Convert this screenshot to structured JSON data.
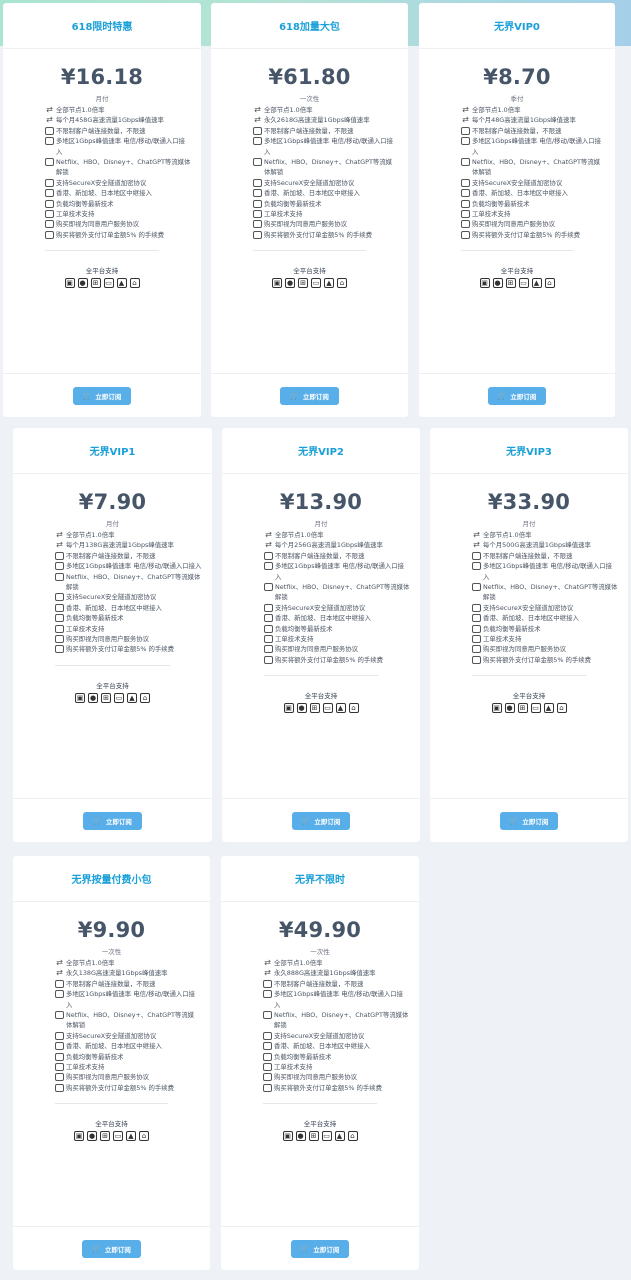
{
  "common": {
    "platform_label": "全平台支持",
    "buy_label": "立即订阅",
    "platform_icons": [
      "android-icon",
      "apple-icon",
      "windows-icon",
      "monitor-icon",
      "linux-icon",
      "router-icon"
    ],
    "feature_icons": [
      "arrows-icon",
      "arrows-icon",
      "user-icon",
      "location-icon",
      "play-icon",
      "shield-icon",
      "route-icon",
      "balance-icon",
      "support-icon",
      "agreement-icon",
      "fee-icon"
    ]
  },
  "plans": [
    {
      "title": "618限时特惠",
      "price": "¥16.18",
      "period": "月付",
      "features": [
        "全部节点1.0倍率",
        "每个月458G高速流量1Gbps峰值速率",
        "不限制客户端连接数量，不限速",
        "多地区1Gbps峰值速率 电信/移动/联通入口接入",
        "Netflix、HBO、Disney+、ChatGPT等流媒体解锁",
        "支持SecureX安全隧道加密协议",
        "香港、新加坡、日本地区中继接入",
        "负载均衡等最新技术",
        "工单技术支持",
        "购买即视为同意用户服务协议",
        "购买将额外支付订单金额5% 的手续费"
      ]
    },
    {
      "title": "618加量大包",
      "price": "¥61.80",
      "period": "一次性",
      "features": [
        "全部节点1.0倍率",
        "永久2618G高速流量1Gbps峰值速率",
        "不限制客户端连接数量，不限速",
        "多地区1Gbps峰值速率 电信/移动/联通入口接入",
        "Netflix、HBO、Disney+、ChatGPT等流媒体解锁",
        "支持SecureX安全隧道加密协议",
        "香港、新加坡、日本地区中继接入",
        "负载均衡等最新技术",
        "工单技术支持",
        "购买即视为同意用户服务协议",
        "购买将额外支付订单金额5% 的手续费"
      ]
    },
    {
      "title": "无界VIP0",
      "price": "¥8.70",
      "period": "季付",
      "features": [
        "全部节点1.0倍率",
        "每个月48G高速流量1Gbps峰值速率",
        "不限制客户端连接数量，不限速",
        "多地区1Gbps峰值速率 电信/移动/联通入口接入",
        "Netflix、HBO、Disney+、ChatGPT等流媒体解锁",
        "支持SecureX安全隧道加密协议",
        "香港、新加坡、日本地区中继接入",
        "负载均衡等最新技术",
        "工单技术支持",
        "购买即视为同意用户服务协议",
        "购买将额外支付订单金额5% 的手续费"
      ]
    },
    {
      "title": "无界VIP1",
      "price": "¥7.90",
      "period": "月付",
      "features": [
        "全部节点1.0倍率",
        "每个月138G高速流量1Gbps峰值速率",
        "不限制客户端连接数量，不限速",
        "多地区1Gbps峰值速率 电信/移动/联通入口接入",
        "Netflix、HBO、Disney+、ChatGPT等流媒体解锁",
        "支持SecureX安全隧道加密协议",
        "香港、新加坡、日本地区中继接入",
        "负载均衡等最新技术",
        "工单技术支持",
        "购买即视为同意用户服务协议",
        "购买将额外支付订单金额5% 的手续费"
      ]
    },
    {
      "title": "无界VIP2",
      "price": "¥13.90",
      "period": "月付",
      "features": [
        "全部节点1.0倍率",
        "每个月256G高速流量1Gbps峰值速率",
        "不限制客户端连接数量，不限速",
        "多地区1Gbps峰值速率 电信/移动/联通入口接入",
        "Netflix、HBO、Disney+、ChatGPT等流媒体解锁",
        "支持SecureX安全隧道加密协议",
        "香港、新加坡、日本地区中继接入",
        "负载均衡等最新技术",
        "工单技术支持",
        "购买即视为同意用户服务协议",
        "购买将额外支付订单金额5% 的手续费"
      ]
    },
    {
      "title": "无界VIP3",
      "price": "¥33.90",
      "period": "月付",
      "features": [
        "全部节点1.0倍率",
        "每个月500G高速流量1Gbps峰值速率",
        "不限制客户端连接数量，不限速",
        "多地区1Gbps峰值速率 电信/移动/联通入口接入",
        "Netflix、HBO、Disney+、ChatGPT等流媒体解锁",
        "支持SecureX安全隧道加密协议",
        "香港、新加坡、日本地区中继接入",
        "负载均衡等最新技术",
        "工单技术支持",
        "购买即视为同意用户服务协议",
        "购买将额外支付订单金额5% 的手续费"
      ]
    },
    {
      "title": "无界按量付费小包",
      "price": "¥9.90",
      "period": "一次性",
      "features": [
        "全部节点1.0倍率",
        "永久138G高速流量1Gbps峰值速率",
        "不限制客户端连接数量，不限速",
        "多地区1Gbps峰值速率 电信/移动/联通入口接入",
        "Netflix、HBO、Disney+、ChatGPT等流媒体解锁",
        "支持SecureX安全隧道加密协议",
        "香港、新加坡、日本地区中继接入",
        "负载均衡等最新技术",
        "工单技术支持",
        "购买即视为同意用户服务协议",
        "购买将额外支付订单金额5% 的手续费"
      ]
    },
    {
      "title": "无界不限时",
      "price": "¥49.90",
      "period": "一次性",
      "features": [
        "全部节点1.0倍率",
        "永久888G高速流量1Gbps峰值速率",
        "不限制客户端连接数量，不限速",
        "多地区1Gbps峰值速率 电信/移动/联通入口接入",
        "Netflix、HBO、Disney+、ChatGPT等流媒体解锁",
        "支持SecureX安全隧道加密协议",
        "香港、新加坡、日本地区中继接入",
        "负载均衡等最新技术",
        "工单技术支持",
        "购买即视为同意用户服务协议",
        "购买将额外支付订单金额5% 的手续费"
      ]
    }
  ]
}
